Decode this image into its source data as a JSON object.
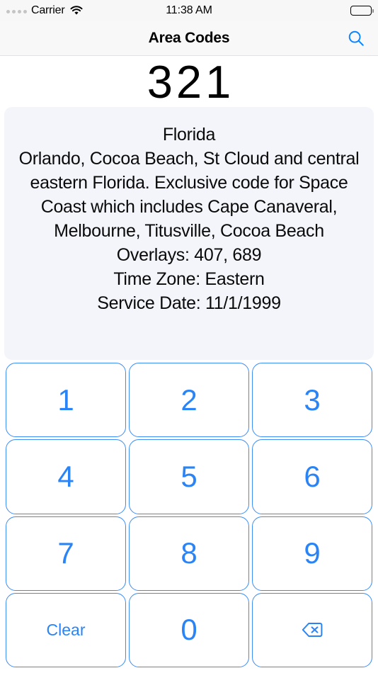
{
  "status_bar": {
    "carrier": "Carrier",
    "time": "11:38 AM",
    "signal_icon": "signal-dots-icon",
    "wifi_icon": "wifi-icon",
    "battery_icon": "battery-full-icon"
  },
  "nav_bar": {
    "title": "Area Codes",
    "search_icon": "search-icon"
  },
  "display": {
    "area_code": "321"
  },
  "info_card": {
    "state": "Florida",
    "description": "Orlando, Cocoa Beach, St Cloud and central eastern Florida. Exclusive code for Space Coast which includes Cape Canaveral, Melbourne, Titusville, Cocoa Beach",
    "overlays": "Overlays: 407, 689",
    "time_zone": "Time Zone: Eastern",
    "service_date": "Service Date: 11/1/1999"
  },
  "keypad": {
    "rows": [
      [
        {
          "name": "key-1",
          "label": "1",
          "type": "digit"
        },
        {
          "name": "key-2",
          "label": "2",
          "type": "digit"
        },
        {
          "name": "key-3",
          "label": "3",
          "type": "digit"
        }
      ],
      [
        {
          "name": "key-4",
          "label": "4",
          "type": "digit"
        },
        {
          "name": "key-5",
          "label": "5",
          "type": "digit"
        },
        {
          "name": "key-6",
          "label": "6",
          "type": "digit"
        }
      ],
      [
        {
          "name": "key-7",
          "label": "7",
          "type": "digit"
        },
        {
          "name": "key-8",
          "label": "8",
          "type": "digit"
        },
        {
          "name": "key-9",
          "label": "9",
          "type": "digit"
        }
      ],
      [
        {
          "name": "key-clear",
          "label": "Clear",
          "type": "clear"
        },
        {
          "name": "key-0",
          "label": "0",
          "type": "digit"
        },
        {
          "name": "key-backspace",
          "label": "",
          "type": "backspace",
          "icon": "backspace-icon"
        }
      ]
    ]
  },
  "colors": {
    "accent_blue": "#2a84f5",
    "key_border": "#3b8cf7",
    "card_background": "#f4f5fa",
    "nav_background": "#f8f8f8",
    "status_background": "#f7f7f7"
  }
}
